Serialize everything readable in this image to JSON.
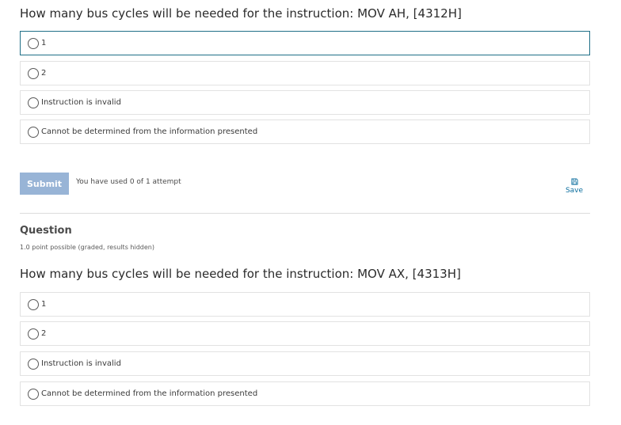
{
  "question1": {
    "text": "How many bus cycles will be needed for the instruction: MOV AH, [4312H]",
    "choices": [
      {
        "label": "1"
      },
      {
        "label": "2"
      },
      {
        "label": "Instruction is invalid"
      },
      {
        "label": "Cannot be determined from the information presented"
      }
    ]
  },
  "actions": {
    "submit_label": "Submit",
    "attempts_text": "You have used 0 of 1 attempt",
    "save_label": "Save",
    "save_icon": "floppy-disk-icon"
  },
  "question2": {
    "heading": "Question",
    "points": "1.0 point possible (graded, results hidden)",
    "text": "How many bus cycles will be needed for the instruction: MOV AX, [4313H]",
    "choices": [
      {
        "label": "1"
      },
      {
        "label": "2"
      },
      {
        "label": "Instruction is invalid"
      },
      {
        "label": "Cannot be determined from the information presented"
      }
    ]
  },
  "colors": {
    "focus_border": "#1f6f87",
    "submit_bg": "#98b4d6",
    "link": "#0c6e9e"
  }
}
